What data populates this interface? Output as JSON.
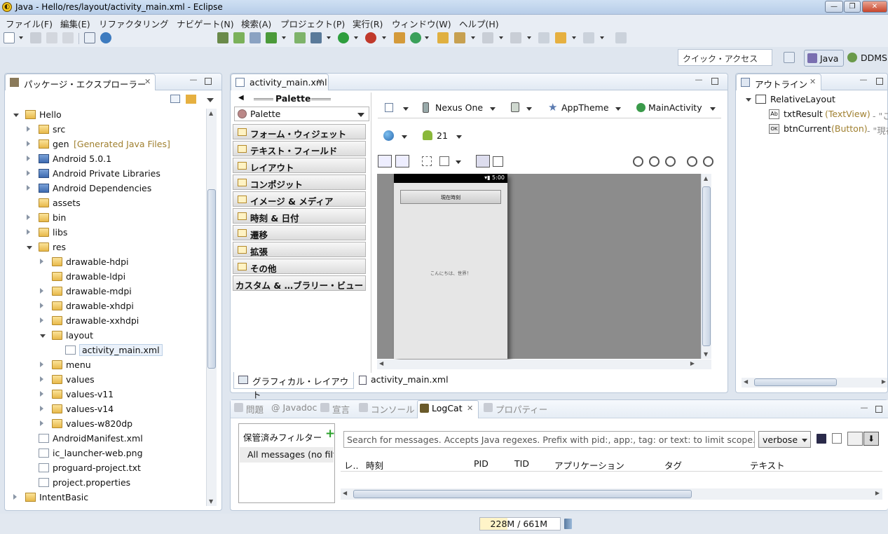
{
  "window": {
    "title": "Java - Hello/res/layout/activity_main.xml - Eclipse",
    "buttons": [
      "—",
      "❐",
      "✕"
    ]
  },
  "menu": [
    "ファイル(F)",
    "編集(E)",
    "リファクタリング",
    "ナビゲート(N)",
    "検索(A)",
    "プロジェクト(P)",
    "実行(R)",
    "ウィンドウ(W)",
    "ヘルプ(H)"
  ],
  "quick_access": {
    "placeholder": "クイック・アクセス"
  },
  "perspectives": [
    {
      "label": "Java",
      "active": true
    },
    {
      "label": "DDMS",
      "active": false
    }
  ],
  "package_explorer": {
    "title": "パッケージ・エクスプローラー",
    "items": [
      {
        "label": "Hello",
        "depth": 0,
        "expander": "open",
        "icon": "project-icon"
      },
      {
        "label": "src",
        "depth": 1,
        "expander": "closed",
        "icon": "source-folder-icon"
      },
      {
        "label": "gen",
        "suffix": "[Generated Java Files]",
        "depth": 1,
        "expander": "closed",
        "icon": "source-folder-icon"
      },
      {
        "label": "Android 5.0.1",
        "depth": 1,
        "expander": "closed",
        "icon": "library-icon"
      },
      {
        "label": "Android Private Libraries",
        "depth": 1,
        "expander": "closed",
        "icon": "library-icon"
      },
      {
        "label": "Android Dependencies",
        "depth": 1,
        "expander": "closed",
        "icon": "library-icon"
      },
      {
        "label": "assets",
        "depth": 1,
        "expander": "none",
        "icon": "folder-icon"
      },
      {
        "label": "bin",
        "depth": 1,
        "expander": "closed",
        "icon": "folder-icon"
      },
      {
        "label": "libs",
        "depth": 1,
        "expander": "closed",
        "icon": "folder-icon"
      },
      {
        "label": "res",
        "depth": 1,
        "expander": "open",
        "icon": "folder-icon"
      },
      {
        "label": "drawable-hdpi",
        "depth": 2,
        "expander": "closed",
        "icon": "folder-icon"
      },
      {
        "label": "drawable-ldpi",
        "depth": 2,
        "expander": "none",
        "icon": "folder-icon"
      },
      {
        "label": "drawable-mdpi",
        "depth": 2,
        "expander": "closed",
        "icon": "folder-icon"
      },
      {
        "label": "drawable-xhdpi",
        "depth": 2,
        "expander": "closed",
        "icon": "folder-icon"
      },
      {
        "label": "drawable-xxhdpi",
        "depth": 2,
        "expander": "closed",
        "icon": "folder-icon"
      },
      {
        "label": "layout",
        "depth": 2,
        "expander": "open",
        "icon": "folder-icon"
      },
      {
        "label": "activity_main.xml",
        "depth": 3,
        "expander": "none",
        "icon": "xml-file-icon",
        "selected": true
      },
      {
        "label": "menu",
        "depth": 2,
        "expander": "closed",
        "icon": "folder-icon"
      },
      {
        "label": "values",
        "depth": 2,
        "expander": "closed",
        "icon": "folder-icon"
      },
      {
        "label": "values-v11",
        "depth": 2,
        "expander": "closed",
        "icon": "folder-icon"
      },
      {
        "label": "values-v14",
        "depth": 2,
        "expander": "closed",
        "icon": "folder-icon"
      },
      {
        "label": "values-w820dp",
        "depth": 2,
        "expander": "closed",
        "icon": "folder-icon"
      },
      {
        "label": "AndroidManifest.xml",
        "depth": 1,
        "expander": "none",
        "icon": "xml-file-icon"
      },
      {
        "label": "ic_launcher-web.png",
        "depth": 1,
        "expander": "none",
        "icon": "image-file-icon"
      },
      {
        "label": "proguard-project.txt",
        "depth": 1,
        "expander": "none",
        "icon": "text-file-icon"
      },
      {
        "label": "project.properties",
        "depth": 1,
        "expander": "none",
        "icon": "text-file-icon"
      },
      {
        "label": "IntentBasic",
        "depth": 0,
        "expander": "closed",
        "icon": "project-icon"
      }
    ]
  },
  "editor": {
    "tab": "activity_main.xml",
    "palette": {
      "header": "Palette",
      "dropdown": "Palette",
      "categories": [
        "フォーム・ウィジェット",
        "テキスト・フィールド",
        "レイアウト",
        "コンポジット",
        "イメージ & メディア",
        "時刻 & 日付",
        "遷移",
        "拡張",
        "その他"
      ],
      "custom": "カスタム & …ブラリー・ビュー"
    },
    "config": {
      "device": "Nexus One",
      "theme": "AppTheme",
      "activity": "MainActivity",
      "api": "21"
    },
    "preview": {
      "status_time": "5:00",
      "button_text": "現在時刻",
      "hello_text": "こんにちは、世界！"
    },
    "bottom_tabs": [
      "グラフィカル・レイアウト",
      "activity_main.xml"
    ]
  },
  "outline": {
    "title": "アウトライン",
    "items": [
      {
        "label": "RelativeLayout",
        "depth": 0
      },
      {
        "label": "txtResult",
        "type": "(TextView)",
        "rest": " - \"こ",
        "depth": 1,
        "badge": "Ab"
      },
      {
        "label": "btnCurrent",
        "type": "(Button)",
        "rest": " - \"現在",
        "depth": 1,
        "badge": "OK"
      }
    ]
  },
  "bottom": {
    "tabs": [
      "問題",
      "@ Javadoc",
      "宣言",
      "コンソール",
      "LogCat",
      "プロパティー"
    ],
    "active": "LogCat",
    "filters_label": "保管済みフィルター",
    "filter_item": "All messages (no filte",
    "search_placeholder": "Search for messages. Accepts Java regexes. Prefix with pid:, app:, tag: or text: to limit scope.",
    "level": "verbose",
    "columns": [
      "レ..",
      "時刻",
      "PID",
      "TID",
      "アプリケーション",
      "タグ",
      "テキスト"
    ]
  },
  "status": {
    "heap": "228M / 661M",
    "heap_fraction": 0.345
  }
}
